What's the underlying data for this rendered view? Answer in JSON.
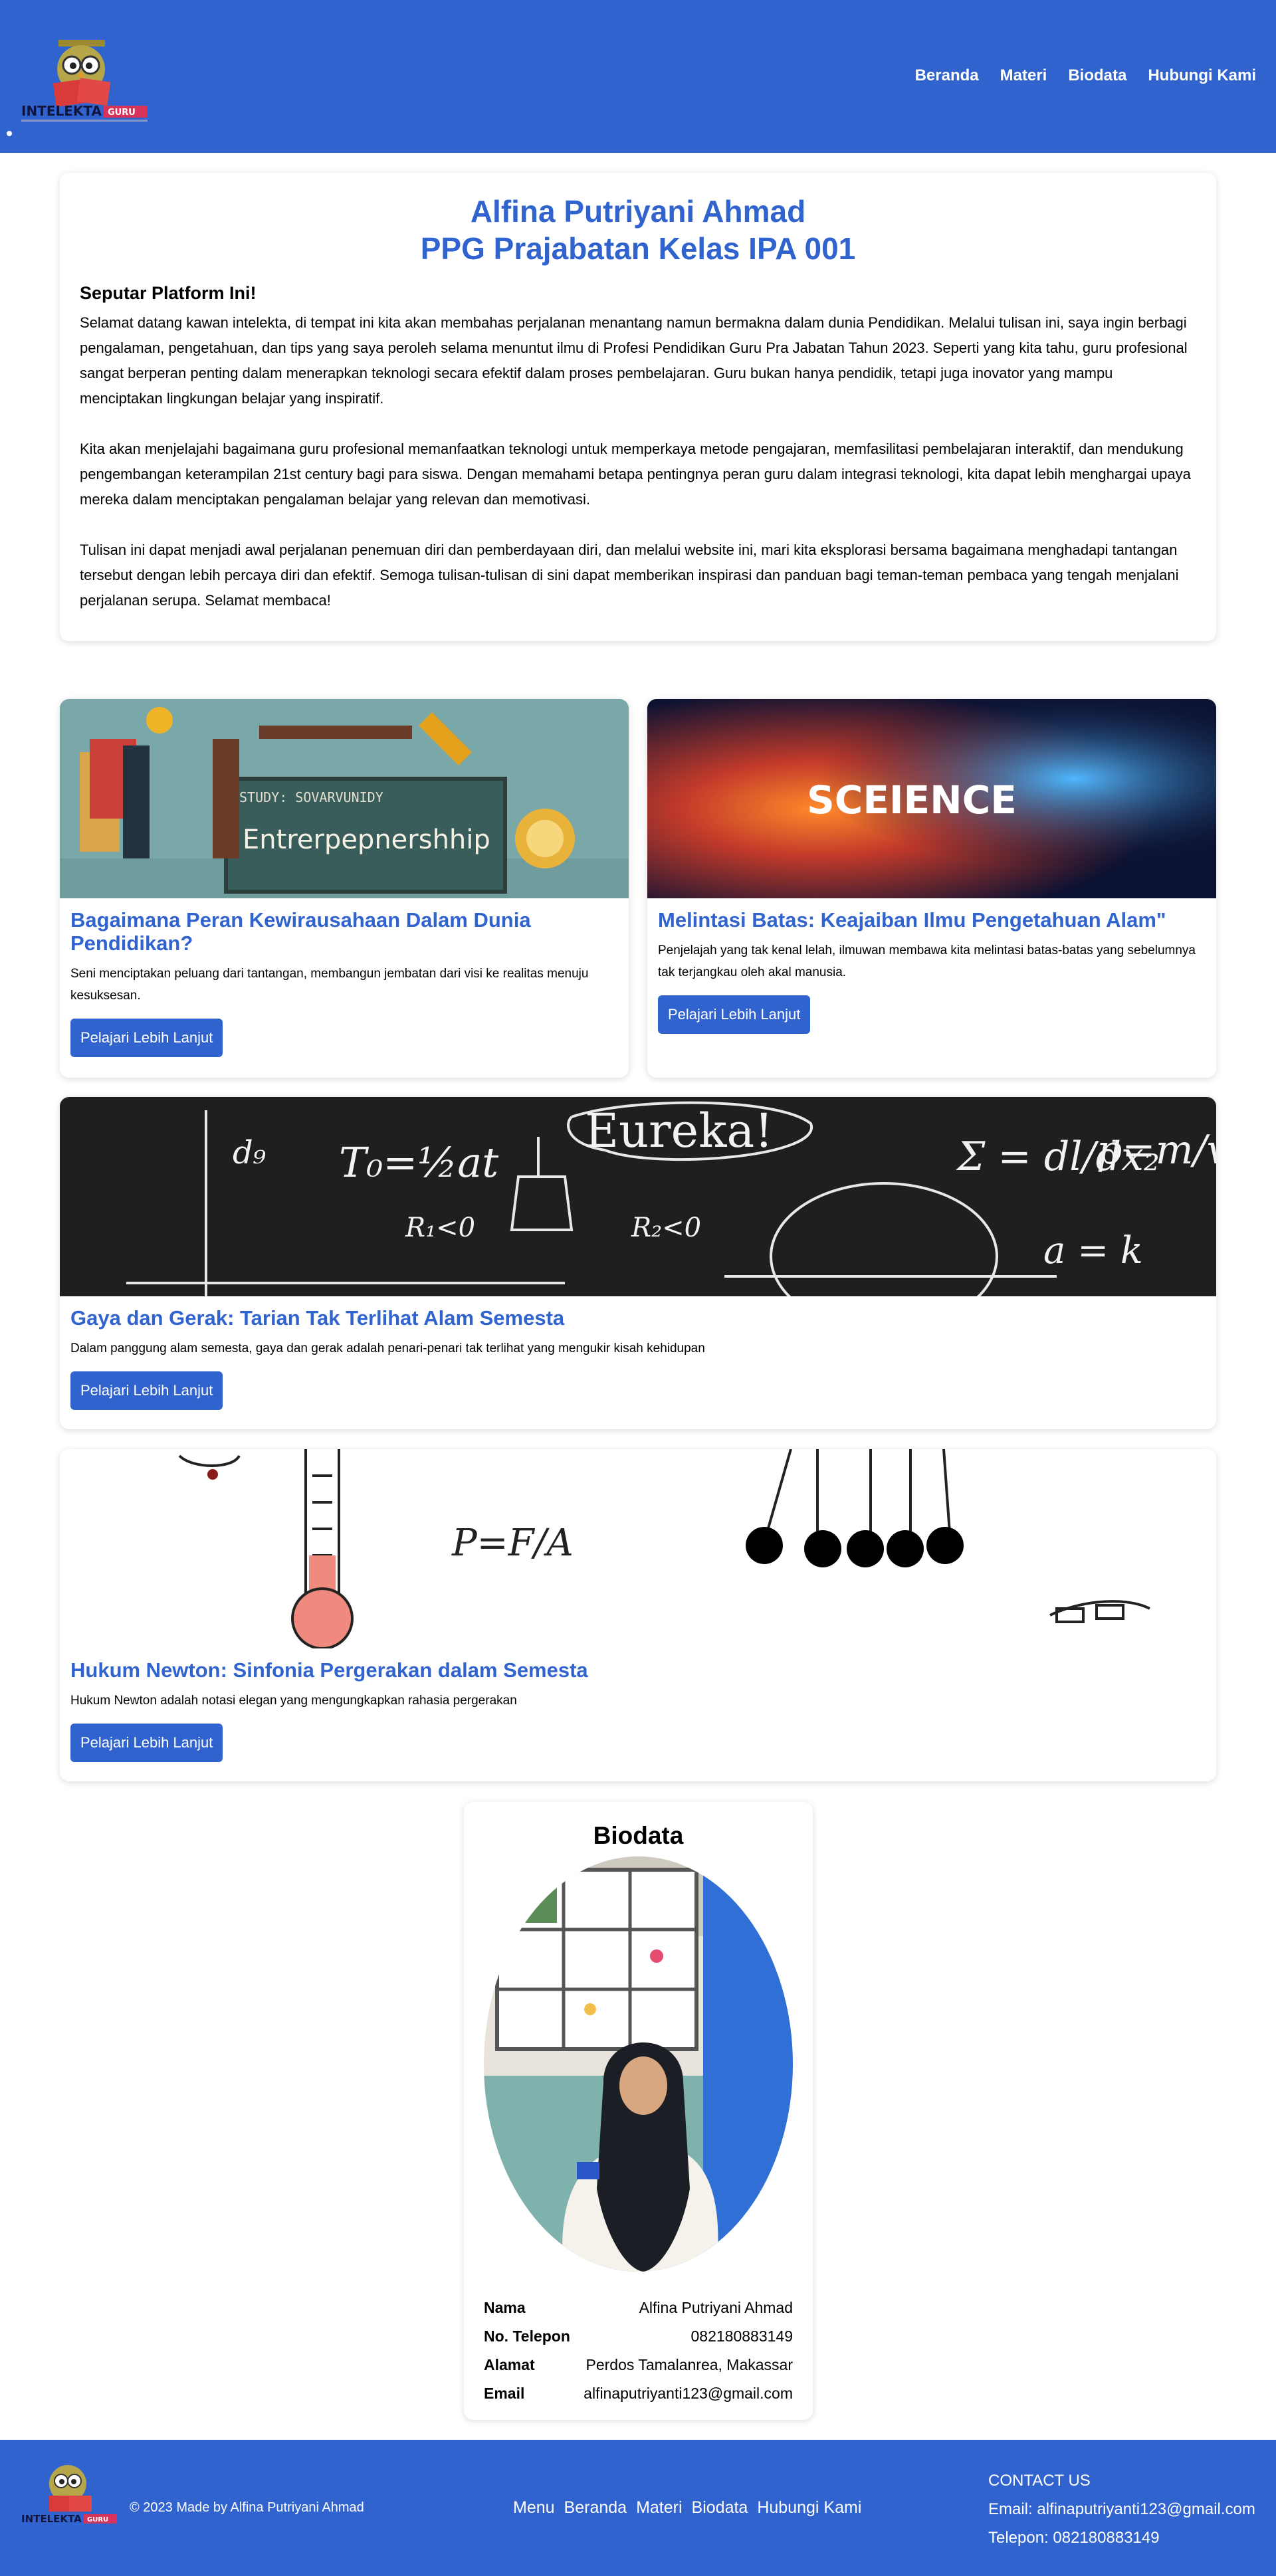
{
  "header": {
    "nav": [
      "Beranda",
      "Materi",
      "Biodata",
      "Hubungi Kami"
    ],
    "logo_text": "INTELEKTA",
    "logo_tag": "GURU"
  },
  "intro": {
    "name": "Alfina Putriyani Ahmad",
    "program": "PPG Prajabatan Kelas IPA 001",
    "heading": "Seputar Platform Ini!",
    "paragraphs": [
      "Selamat datang kawan intelekta, di tempat ini kita akan membahas perjalanan menantang namun bermakna dalam dunia Pendidikan. Melalui tulisan ini, saya ingin berbagi pengalaman, pengetahuan, dan tips yang saya peroleh selama menuntut ilmu di Profesi Pendidikan Guru Pra Jabatan Tahun 2023. Seperti yang kita tahu, guru profesional sangat berperan penting dalam menerapkan teknologi secara efektif dalam proses pembelajaran. Guru bukan hanya pendidik, tetapi juga inovator yang mampu menciptakan lingkungan belajar yang inspiratif.",
      "Kita akan menjelajahi bagaimana guru profesional memanfaatkan teknologi untuk memperkaya metode pengajaran, memfasilitasi pembelajaran interaktif, dan mendukung pengembangan keterampilan 21st century bagi para siswa. Dengan memahami betapa pentingnya peran guru dalam integrasi teknologi, kita dapat lebih menghargai upaya mereka dalam menciptakan pengalaman belajar yang relevan dan memotivasi.",
      "Tulisan ini dapat menjadi awal perjalanan penemuan diri dan pemberdayaan diri, dan melalui website ini, mari kita eksplorasi bersama bagaimana menghadapi tantangan tersebut dengan lebih percaya diri dan efektif. Semoga tulisan-tulisan di sini dapat memberikan inspirasi dan panduan bagi teman-teman pembaca yang tengah menjalani perjalanan serupa. Selamat membaca!"
    ]
  },
  "articles": [
    {
      "title": "Bagaimana Peran Kewirausahaan Dalam Dunia Pendidikan?",
      "desc": "Seni menciptakan peluang dari tantangan, membangun jembatan dari visi ke realitas menuju kesuksesan.",
      "button": "Pelajari Lebih Lanjut",
      "image_text": "Entrerpepnershhip",
      "image_sub": "STUDY: SOVARVUNIDY"
    },
    {
      "title": "Melintasi Batas: Keajaiban Ilmu Pengetahuan Alam\"",
      "desc": "Penjelajah yang tak kenal lelah, ilmuwan membawa kita melintasi batas-batas yang sebelumnya tak terjangkau oleh akal manusia.",
      "button": "Pelajari Lebih Lanjut",
      "image_text": "SCEIENCE"
    },
    {
      "title": "Gaya dan Gerak: Tarian Tak Terlihat Alam Semesta",
      "desc": "Dalam panggung alam semesta, gaya dan gerak adalah penari-penari tak terlihat yang mengukir kisah kehidupan",
      "button": "Pelajari Lebih Lanjut",
      "image_text": "Eureka!"
    },
    {
      "title": "Hukum Newton: Sinfonia Pergerakan dalam Semesta",
      "desc": "Hukum Newton adalah notasi elegan yang mengungkapkan rahasia pergerakan",
      "button": "Pelajari Lebih Lanjut"
    }
  ],
  "biodata": {
    "title": "Biodata",
    "rows": [
      {
        "label": "Nama",
        "value": "Alfina Putriyani Ahmad"
      },
      {
        "label": "No. Telepon",
        "value": "082180883149"
      },
      {
        "label": "Alamat",
        "value": "Perdos Tamalanrea, Makassar"
      },
      {
        "label": "Email",
        "value": "alfinaputriyanti123@gmail.com"
      }
    ]
  },
  "footer": {
    "copyright": "© 2023 Made by Alfina Putriyani Ahmad",
    "nav": [
      "Menu",
      "Beranda",
      "Materi",
      "Biodata",
      "Hubungi Kami"
    ],
    "contact_title": "CONTACT US",
    "contact_email": "Email: alfinaputriyanti123@gmail.com",
    "contact_phone": "Telepon: 082180883149"
  },
  "colors": {
    "primary": "#3163cf",
    "text": "#000000",
    "background": "#ffffff"
  }
}
